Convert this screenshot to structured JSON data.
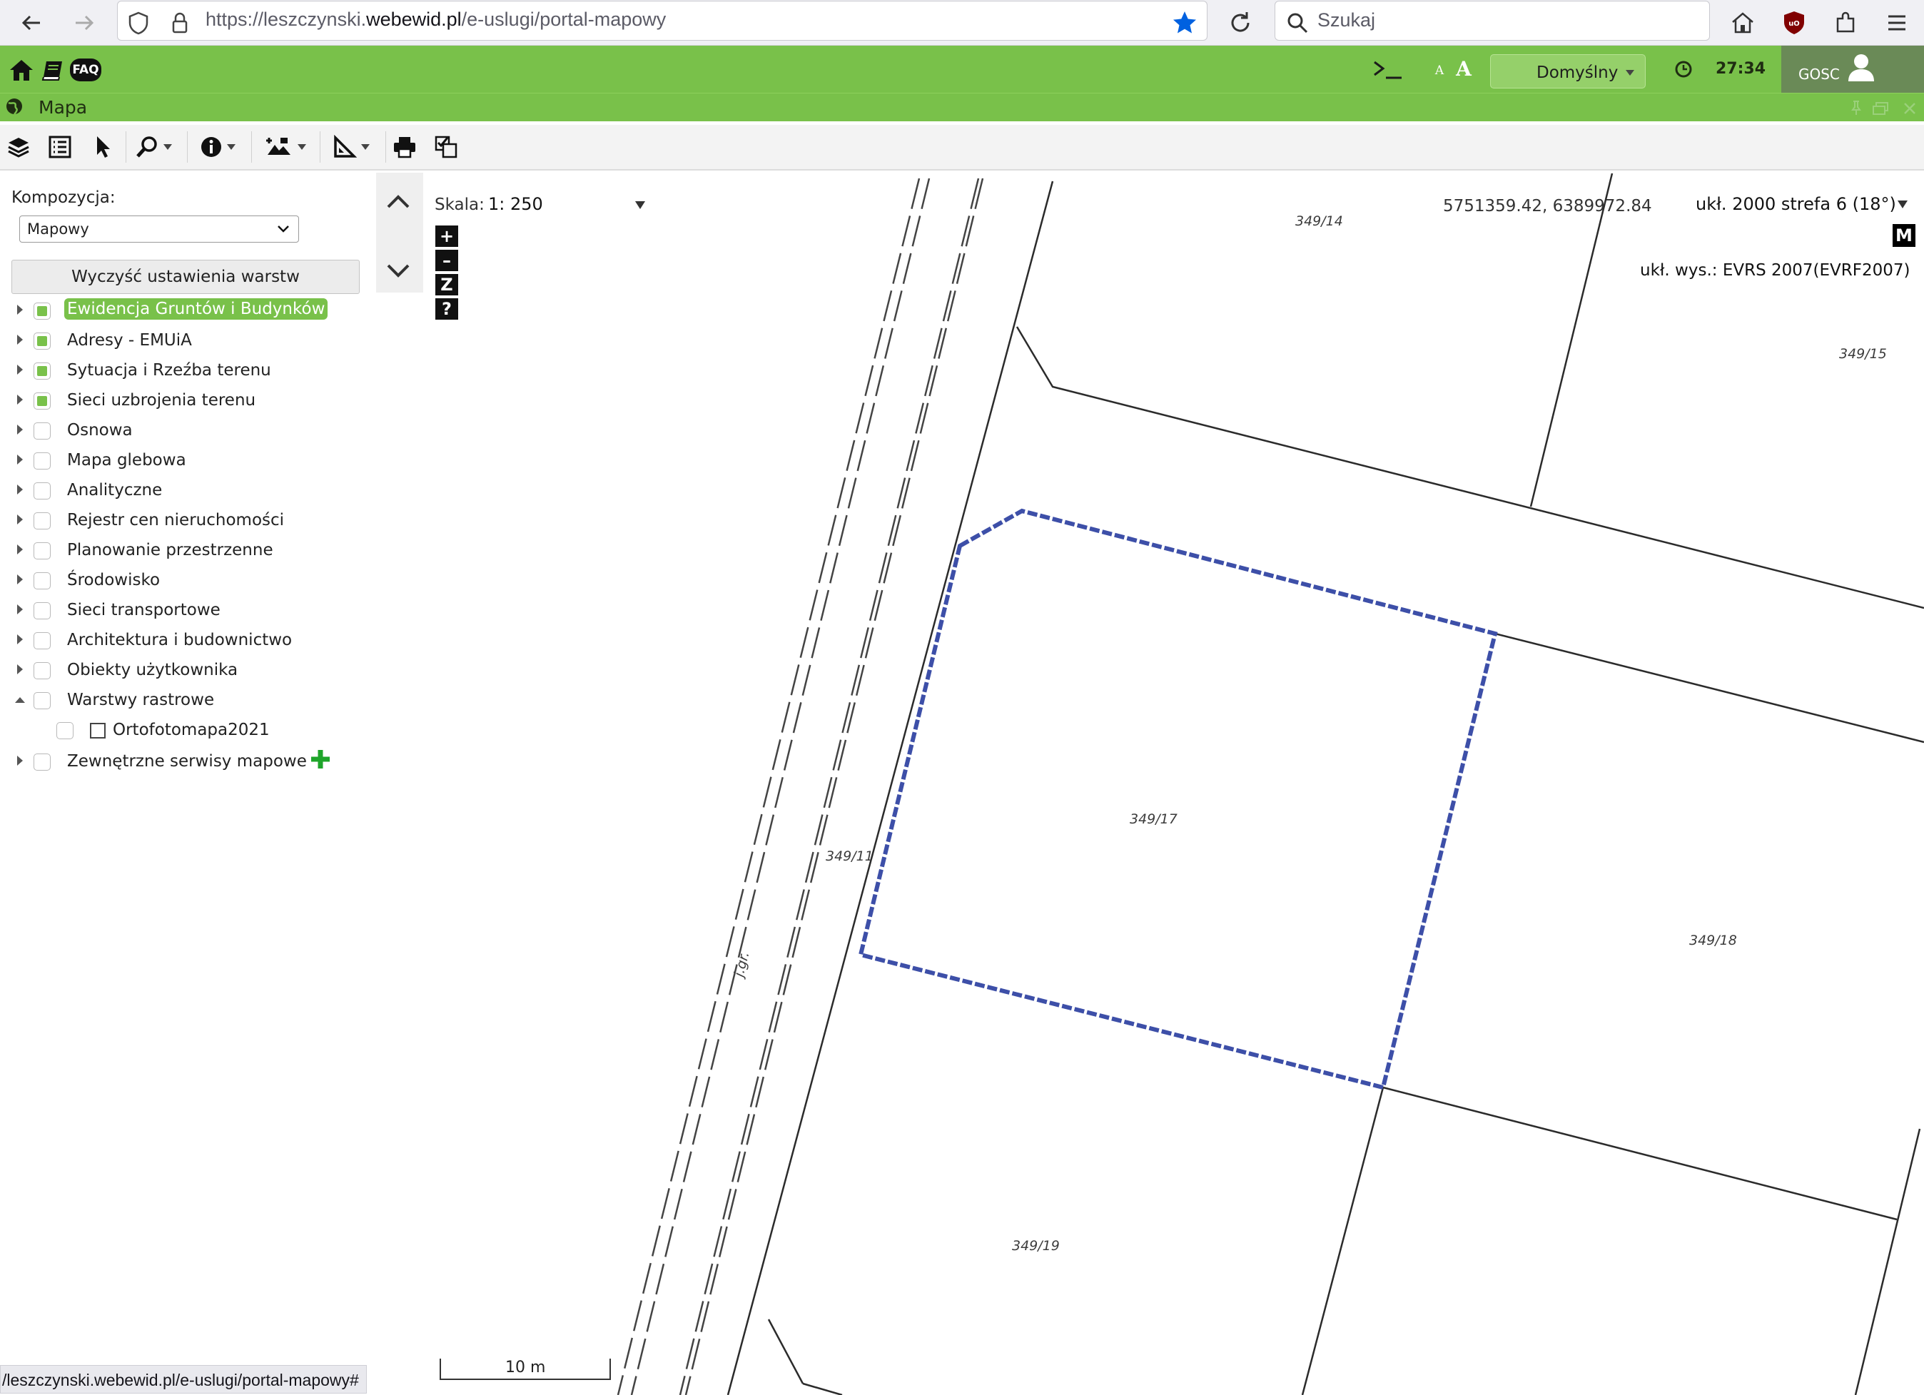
{
  "browser": {
    "url_prefix": "https://leszczynski.",
    "url_domain": "webewid.pl",
    "url_path": "/e-uslugi/portal-mapowy",
    "search_placeholder": "Szukaj"
  },
  "header": {
    "faq_label": "FAQ",
    "font_small": "A",
    "font_large": "A",
    "profile_label": "Domyślny",
    "timer": "27:34",
    "user_label": "GOSC"
  },
  "window": {
    "title": "Mapa"
  },
  "left_panel": {
    "composition_label": "Kompozycja:",
    "composition_value": "Mapowy",
    "clear_button": "Wyczyść ustawienia warstw",
    "layers": [
      {
        "label": "Ewidencja Gruntów i Budynków",
        "checked": true,
        "highlighted": true
      },
      {
        "label": "Adresy - EMUiA",
        "checked": true
      },
      {
        "label": "Sytuacja i Rzeźba terenu",
        "checked": true
      },
      {
        "label": "Sieci uzbrojenia terenu",
        "checked": true
      },
      {
        "label": "Osnowa",
        "checked": false
      },
      {
        "label": "Mapa glebowa",
        "checked": false
      },
      {
        "label": "Analityczne",
        "checked": false
      },
      {
        "label": "Rejestr cen nieruchomości",
        "checked": false
      },
      {
        "label": "Planowanie przestrzenne",
        "checked": false
      },
      {
        "label": "Środowisko",
        "checked": false
      },
      {
        "label": "Sieci transportowe",
        "checked": false
      },
      {
        "label": "Architektura i budownictwo",
        "checked": false
      },
      {
        "label": "Obiekty użytkownika",
        "checked": false
      },
      {
        "label": "Warstwy rastrowe",
        "checked": false,
        "expanded": true
      },
      {
        "label": "Ortofotomapa2021",
        "checked": false,
        "child": true
      },
      {
        "label": "Zewnętrzne serwisy mapowe",
        "checked": false
      }
    ]
  },
  "map": {
    "scale_label": "Skala:",
    "scale_value": "1: 250",
    "zoom_buttons": [
      "+",
      "–",
      "Z",
      "?"
    ],
    "coordinates": "5751359.42, 6389972.84",
    "crs": "ukł. 2000 strefa 6 (18°)",
    "m_button": "M",
    "height_system": "ukł. wys.: EVRS 2007(EVRF2007)",
    "scalebar": "10 m",
    "parcels": [
      "349/14",
      "349/15",
      "349/17",
      "349/11",
      "349/18",
      "349/19"
    ],
    "road_label": "j.gr.",
    "selection_color": "#3d4fa8"
  },
  "statusbar": {
    "text": "/leszczynski.webewid.pl/e-uslugi/portal-mapowy#"
  }
}
